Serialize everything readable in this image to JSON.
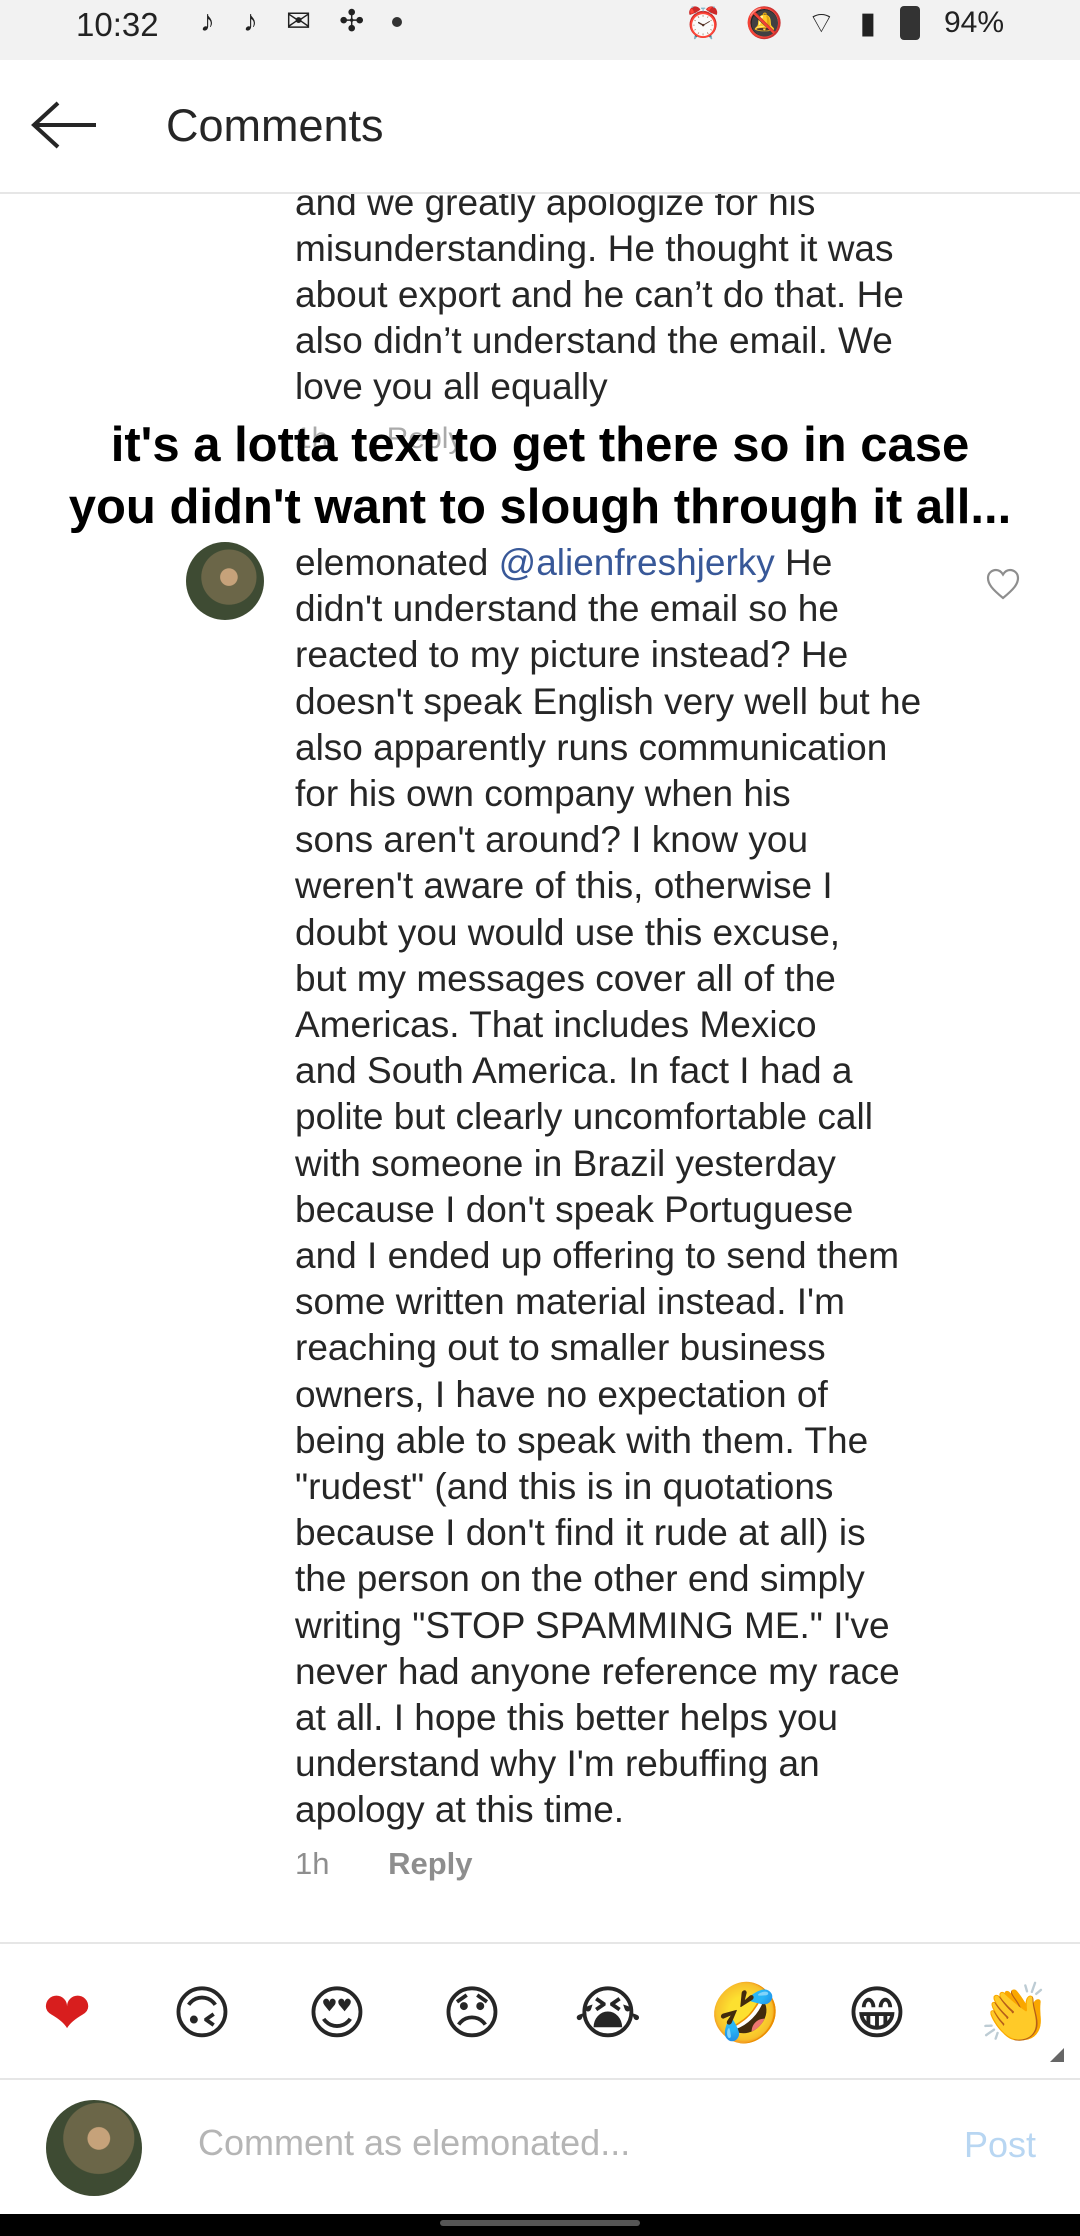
{
  "status_bar": {
    "time": "10:32",
    "battery": "94%",
    "icons": [
      "tiktok-icon",
      "tiktok-icon",
      "gmail-icon",
      "slack-icon",
      "notification-dot",
      "alarm-icon",
      "mute-icon",
      "wifi-icon",
      "signal-icon",
      "battery-icon"
    ]
  },
  "header": {
    "title": "Comments"
  },
  "previous_comment": {
    "lines": [
      "and we greatly apologize for his",
      "misunderstanding. He thought it was",
      "about export and he can’t do that. He",
      "also didn’t understand the email. We",
      "love you all equally"
    ],
    "time": "1h",
    "reply_label": "Reply"
  },
  "overlay_caption": {
    "line1": "it's a lotta text to get there so in case",
    "line2": "you didn't want to slough through it all..."
  },
  "comment": {
    "username": "elemonated",
    "mention": "@alienfreshjerky",
    "lines": [
      "He",
      "didn't understand the email so he",
      "reacted to my picture instead? He",
      "doesn't speak English very well but he",
      "also apparently runs communication",
      "for his own company when his",
      "sons aren't around? I know you",
      "weren't aware of this, otherwise I",
      "doubt you would use this excuse,",
      "but my messages cover all of the",
      "Americas. That includes Mexico",
      "and South America. In fact I had a",
      "polite but clearly uncomfortable call",
      "with someone in Brazil yesterday",
      "because I don't speak Portuguese",
      "and I ended up offering to send them",
      "some written material instead. I'm",
      "reaching out to smaller business",
      "owners, I have no expectation of",
      "being able to speak with them. The",
      "\"rudest\" (and this is in quotations",
      "because I don't find it rude at all) is",
      "the person on the other end simply",
      "writing \"STOP SPAMMING ME.\" I've",
      "never had anyone reference my race",
      "at all. I hope this better helps you",
      "understand why I'm rebuffing an",
      "apology at this time."
    ],
    "time": "1h",
    "reply_label": "Reply"
  },
  "reactions": [
    {
      "name": "red-heart-icon",
      "glyph": "❤"
    },
    {
      "name": "upside-down-face-icon",
      "glyph": "🙃"
    },
    {
      "name": "heart-eyes-icon",
      "glyph": "😍"
    },
    {
      "name": "disappointed-face-icon",
      "glyph": "😞"
    },
    {
      "name": "crying-face-icon",
      "glyph": "😭"
    },
    {
      "name": "rolling-laughing-icon",
      "glyph": "🤣"
    },
    {
      "name": "grinning-face-icon",
      "glyph": "😁"
    },
    {
      "name": "clapping-hands-icon",
      "glyph": "👏"
    }
  ],
  "compose": {
    "placeholder": "Comment as elemonated...",
    "post_label": "Post"
  }
}
